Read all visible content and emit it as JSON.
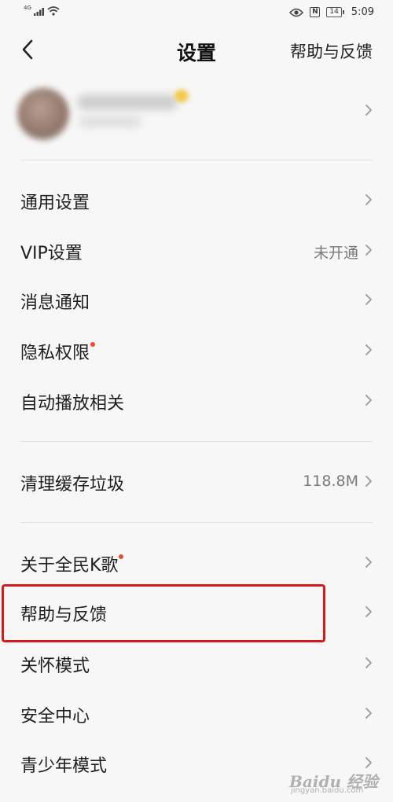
{
  "status_bar": {
    "network": "4G",
    "time": "5:09",
    "battery": "14",
    "nfc": "N"
  },
  "nav": {
    "title": "设置",
    "action": "帮助与反馈"
  },
  "sections": [
    {
      "items": [
        {
          "label": "通用设置",
          "value": "",
          "dot": false
        },
        {
          "label": "VIP设置",
          "value": "未开通",
          "dot": false
        },
        {
          "label": "消息通知",
          "value": "",
          "dot": false
        },
        {
          "label": "隐私权限",
          "value": "",
          "dot": true
        },
        {
          "label": "自动播放相关",
          "value": "",
          "dot": false
        }
      ]
    },
    {
      "items": [
        {
          "label": "清理缓存垃圾",
          "value": "118.8M",
          "dot": false
        }
      ]
    },
    {
      "items": [
        {
          "label": "关于全民K歌",
          "value": "",
          "dot": true
        },
        {
          "label": "帮助与反馈",
          "value": "",
          "dot": false,
          "highlighted": true
        },
        {
          "label": "关怀模式",
          "value": "",
          "dot": false
        },
        {
          "label": "安全中心",
          "value": "",
          "dot": false
        },
        {
          "label": "青少年模式",
          "value": "",
          "dot": false
        }
      ]
    }
  ],
  "colors": {
    "background": "#f7f7f7",
    "badge": "#f04b2e",
    "highlight_border": "#d41a1a"
  },
  "watermark": {
    "text": "Baidu 经验",
    "sub": "jingyan.baidu.com"
  }
}
